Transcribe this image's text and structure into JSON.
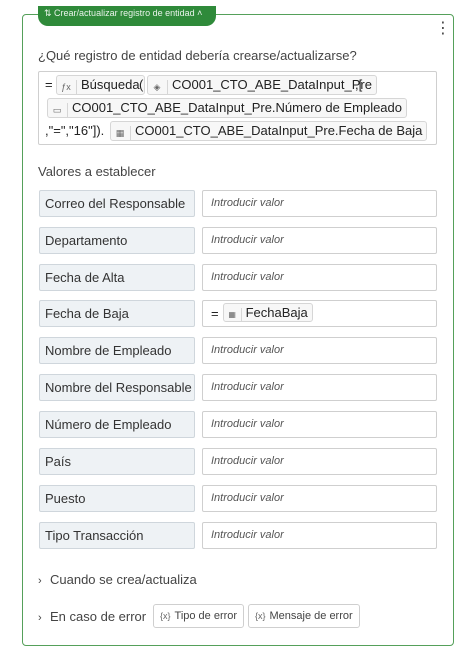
{
  "header": {
    "tab_label": "Crear/actualizar registro de entidad",
    "menu_icon": "more-vertical-icon"
  },
  "question": "¿Qué registro de entidad debería crearse/actualizarse?",
  "formula": {
    "eq": "=",
    "func_name": "Búsqueda",
    "open_paren": "(",
    "table_ref": "CO001_CTO_ABE_DataInput_Pre",
    "comma_bracket": ",[",
    "field_ref": "CO001_CTO_ABE_DataInput_Pre.Número de Empleado",
    "args": ",\"=\",\"16\"]).",
    "tail_ref": "CO001_CTO_ABE_DataInput_Pre.Fecha de Baja",
    "func_icon": "fx-icon",
    "table_icon": "table-icon",
    "field_icon": "field-icon",
    "date_icon": "calendar-icon"
  },
  "values_heading": "Valores a establecer",
  "placeholder": "Introducir valor",
  "fields": [
    {
      "label": "Correo del Responsable"
    },
    {
      "label": "Departamento"
    },
    {
      "label": "Fecha de Alta"
    },
    {
      "label": "Fecha de Baja",
      "value_eq": "=",
      "value": "FechaBaja",
      "value_icon": "calendar-icon"
    },
    {
      "label": "Nombre de Empleado"
    },
    {
      "label": "Nombre del Responsable"
    },
    {
      "label": "Número de Empleado"
    },
    {
      "label": "País"
    },
    {
      "label": "Puesto"
    },
    {
      "label": "Tipo Transacción"
    }
  ],
  "on_create": {
    "label": "Cuando se crea/actualiza",
    "icon": "chevron-right-icon"
  },
  "on_error": {
    "label": "En caso de error",
    "icon": "chevron-right-icon",
    "error_type": "Tipo de error",
    "error_message": "Mensaje de error",
    "var_icon": "variable-icon"
  }
}
